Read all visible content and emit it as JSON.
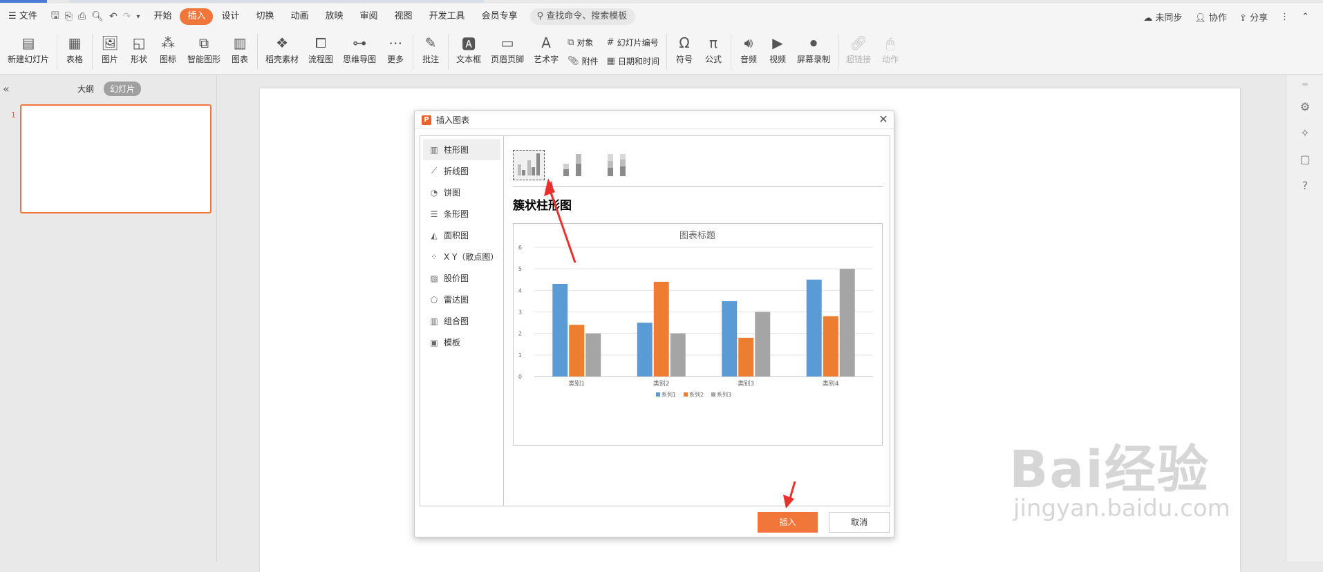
{
  "menubar": {
    "file": "文件",
    "tabs": [
      "开始",
      "插入",
      "设计",
      "切换",
      "动画",
      "放映",
      "审阅",
      "视图",
      "开发工具",
      "会员专享"
    ],
    "active_tab_index": 1,
    "search_placeholder": "查找命令、搜索模板",
    "right": {
      "sync": "未同步",
      "collab": "协作",
      "share": "分享"
    }
  },
  "toolbar": {
    "new_slide": "新建幻灯片",
    "table": "表格",
    "picture": "图片",
    "shape": "形状",
    "icon": "图标",
    "smartart": "智能图形",
    "chart": "图表",
    "material": "稻壳素材",
    "flowchart": "流程图",
    "mindmap": "思维导图",
    "more": "更多",
    "comment": "批注",
    "textbox": "文本框",
    "header_footer": "页眉页脚",
    "wordart": "艺术字",
    "object": "对象",
    "attachment": "附件",
    "slide_number": "幻灯片编号",
    "datetime": "日期和时间",
    "symbol": "符号",
    "formula": "公式",
    "audio": "音频",
    "video": "视频",
    "screen_record": "屏幕录制",
    "hyperlink": "超链接",
    "action": "动作"
  },
  "leftpanel": {
    "outline": "大纲",
    "slides": "幻灯片",
    "slide_number": "1"
  },
  "watermark": {
    "brand": "Bai经验",
    "url": "jingyan.baidu.com"
  },
  "dialog": {
    "title": "插入图表",
    "chart_types": [
      "柱形图",
      "折线图",
      "饼图",
      "条形图",
      "面积图",
      "X Y（散点图）",
      "股价图",
      "雷达图",
      "组合图",
      "模板"
    ],
    "selected_type_index": 0,
    "subtype_name": "簇状柱形图",
    "insert_label": "插入",
    "cancel_label": "取消"
  },
  "chart_data": {
    "type": "bar",
    "title": "图表标题",
    "categories": [
      "类别1",
      "类别2",
      "类别3",
      "类别4"
    ],
    "series": [
      {
        "name": "系列1",
        "values": [
          4.3,
          2.5,
          3.5,
          4.5
        ],
        "color": "#5b9bd5"
      },
      {
        "name": "系列2",
        "values": [
          2.4,
          4.4,
          1.8,
          2.8
        ],
        "color": "#ed7d31"
      },
      {
        "name": "系列3",
        "values": [
          2,
          2,
          3,
          5
        ],
        "color": "#a5a5a5"
      }
    ],
    "ylim": [
      0,
      6
    ],
    "yticks": [
      0,
      1,
      2,
      3,
      4,
      5,
      6
    ],
    "grid": true,
    "legend_position": "bottom"
  }
}
